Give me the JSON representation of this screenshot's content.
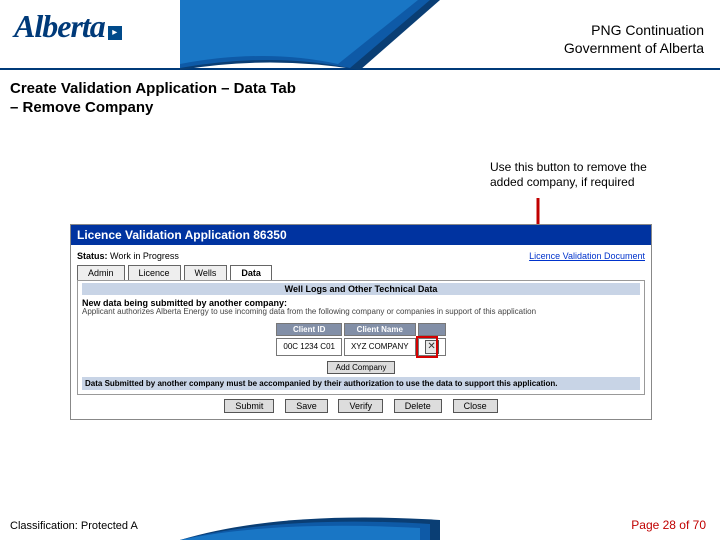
{
  "header": {
    "logo_text": "Alberta",
    "title_line1": "PNG Continuation",
    "title_line2": "Government of Alberta"
  },
  "slide": {
    "title_line1": "Create Validation Application – Data Tab",
    "title_line2": "– Remove Company",
    "annotation": "Use this button to remove the added company, if required"
  },
  "app": {
    "titlebar": "Licence Validation Application 86350",
    "status_label": "Status:",
    "status_value": "Work in Progress",
    "doc_link": "Licence Validation Document",
    "tabs": [
      "Admin",
      "Licence",
      "Wells",
      "Data"
    ],
    "active_tab": "Data",
    "panel_title": "Well Logs and Other Technical Data",
    "section_label": "New data being submitted by another company:",
    "section_body": "Applicant authorizes Alberta Energy to use incoming data from the following company or companies in support of this application",
    "table": {
      "headers": [
        "Client ID",
        "Client Name"
      ],
      "row": {
        "id": "00C 1234 C01",
        "name": "XYZ COMPANY"
      }
    },
    "add_company_btn": "Add Company",
    "data_submitted_note": "Data Submitted by another company must be accompanied by their authorization to use the data to support this application.",
    "actions": [
      "Submit",
      "Save",
      "Verify",
      "Delete",
      "Close"
    ]
  },
  "footer": {
    "classification": "Classification: Protected A",
    "page": "Page 28 of 70"
  }
}
